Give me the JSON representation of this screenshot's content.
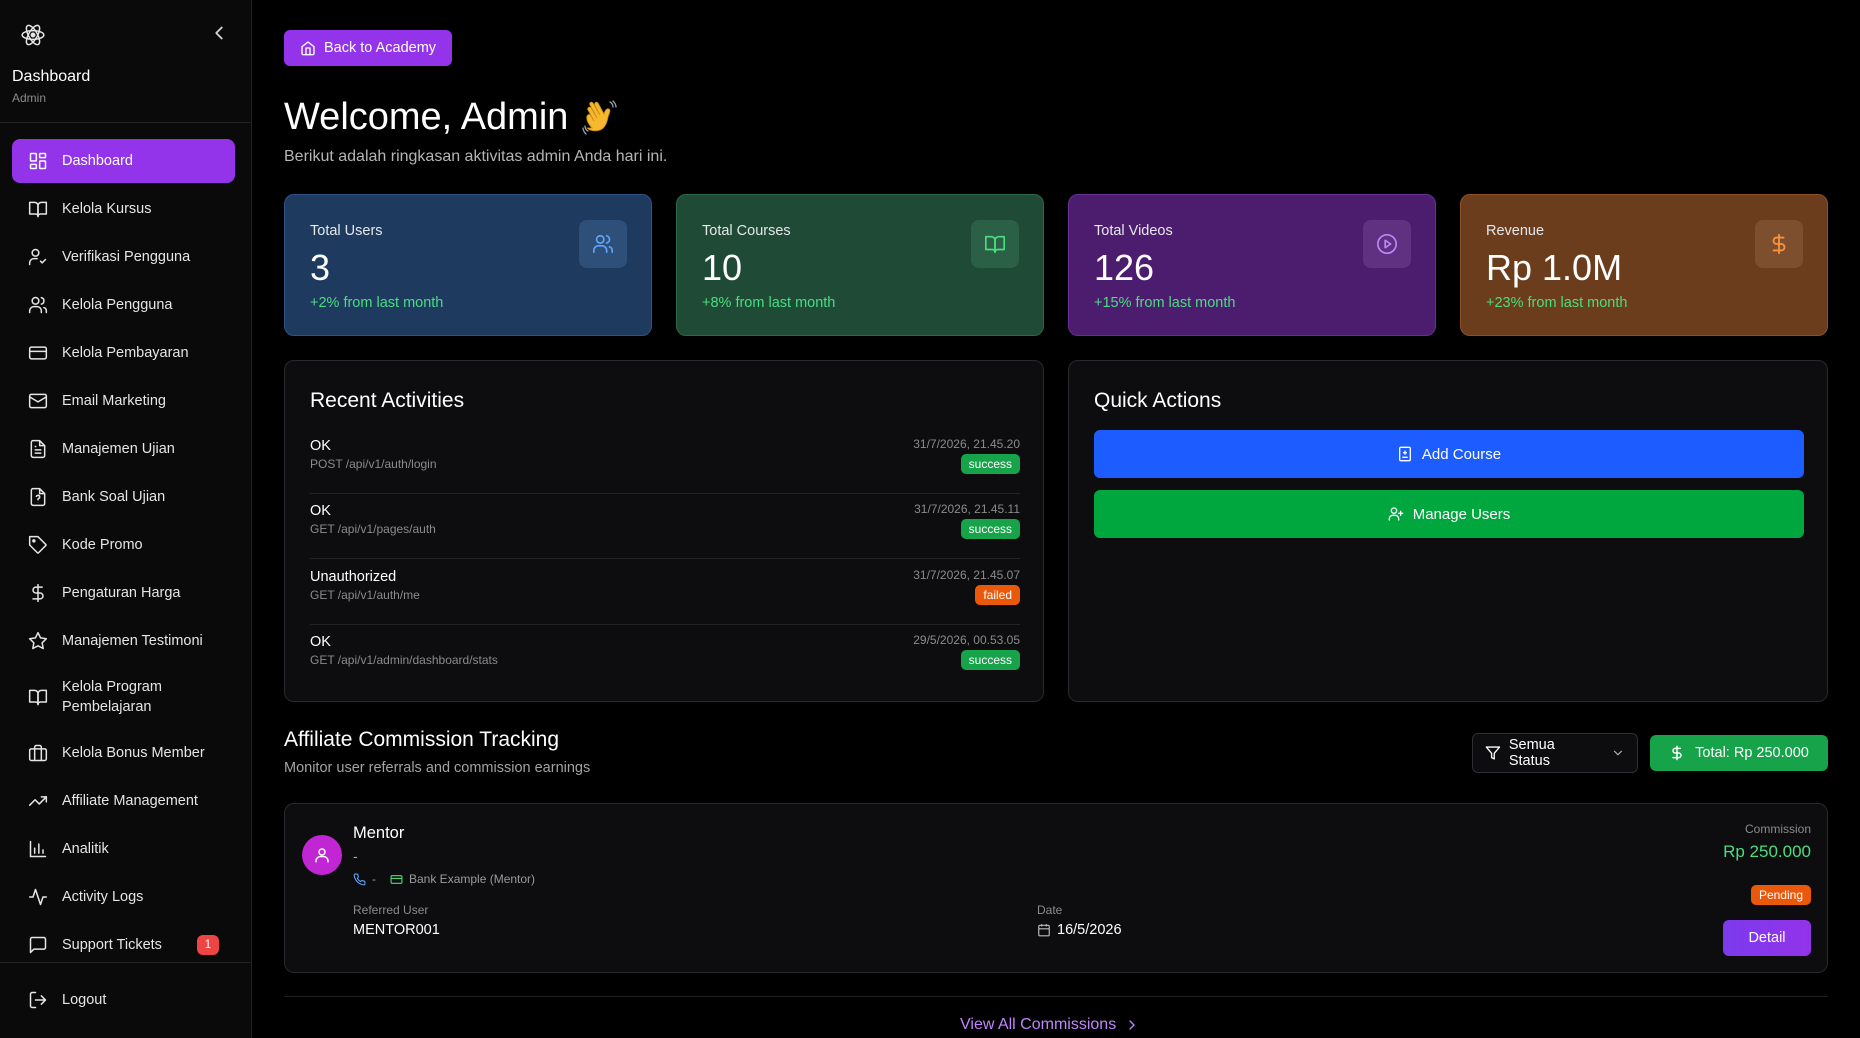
{
  "sidebar": {
    "title": "Dashboard",
    "subtitle": "Admin",
    "items": [
      {
        "label": "Dashboard",
        "icon": "layout-grid-icon"
      },
      {
        "label": "Kelola Kursus",
        "icon": "book-open-icon"
      },
      {
        "label": "Verifikasi Pengguna",
        "icon": "user-check-icon"
      },
      {
        "label": "Kelola Pengguna",
        "icon": "users-icon"
      },
      {
        "label": "Kelola Pembayaran",
        "icon": "credit-card-icon"
      },
      {
        "label": "Email Marketing",
        "icon": "mail-icon"
      },
      {
        "label": "Manajemen Ujian",
        "icon": "file-text-icon"
      },
      {
        "label": "Bank Soal Ujian",
        "icon": "file-question-icon"
      },
      {
        "label": "Kode Promo",
        "icon": "tag-icon"
      },
      {
        "label": "Pengaturan Harga",
        "icon": "dollar-sign-icon"
      },
      {
        "label": "Manajemen Testimoni",
        "icon": "star-icon"
      },
      {
        "label": "Kelola Program Pembelajaran",
        "icon": "book-open-icon"
      },
      {
        "label": "Kelola Bonus Member",
        "icon": "briefcase-icon"
      },
      {
        "label": "Affiliate Management",
        "icon": "trending-up-icon"
      },
      {
        "label": "Analitik",
        "icon": "bar-chart-icon"
      },
      {
        "label": "Activity Logs",
        "icon": "activity-icon"
      },
      {
        "label": "Support Tickets",
        "icon": "message-square-icon",
        "badge": "1"
      }
    ],
    "logout": "Logout"
  },
  "header": {
    "back_button": "Back to Academy",
    "welcome": "Welcome, Admin",
    "subtitle": "Berikut adalah ringkasan aktivitas admin Anda hari ini."
  },
  "stats": [
    {
      "label": "Total Users",
      "value": "3",
      "change": "+2% from last month",
      "icon": "users-icon",
      "bg": "#1e3a5f",
      "icon_color": "#60a5fa"
    },
    {
      "label": "Total Courses",
      "value": "10",
      "change": "+8% from last month",
      "icon": "book-open-icon",
      "bg": "#1f4a35",
      "icon_color": "#4ade80"
    },
    {
      "label": "Total Videos",
      "value": "126",
      "change": "+15% from last month",
      "icon": "play-circle-icon",
      "bg": "#4c1d6e",
      "icon_color": "#c084fc"
    },
    {
      "label": "Revenue",
      "value": "Rp 1.0M",
      "change": "+23% from last month",
      "icon": "dollar-sign-icon",
      "bg": "#6b3d1c",
      "icon_color": "#fb923c"
    }
  ],
  "recent": {
    "title": "Recent Activities",
    "items": [
      {
        "status": "OK",
        "path": "POST /api/v1/auth/login",
        "time": "31/7/2026, 21.45.20",
        "result": "success"
      },
      {
        "status": "OK",
        "path": "GET /api/v1/pages/auth",
        "time": "31/7/2026, 21.45.11",
        "result": "success"
      },
      {
        "status": "Unauthorized",
        "path": "GET /api/v1/auth/me",
        "time": "31/7/2026, 21.45.07",
        "result": "failed"
      },
      {
        "status": "OK",
        "path": "GET /api/v1/admin/dashboard/stats",
        "time": "29/5/2026, 00.53.05",
        "result": "success"
      }
    ]
  },
  "quick": {
    "title": "Quick Actions",
    "add_course": "Add Course",
    "manage_users": "Manage Users"
  },
  "affiliate": {
    "title": "Affiliate Commission Tracking",
    "subtitle": "Monitor user referrals and commission earnings",
    "status_filter": "Semua Status",
    "total": "Total: Rp 250.000",
    "card": {
      "name": "Mentor",
      "dash": "-",
      "phone": "-",
      "bank": "Bank Example (Mentor)",
      "referred_label": "Referred User",
      "referred_value": "MENTOR001",
      "date_label": "Date",
      "date_value": "16/5/2026",
      "commission_label": "Commission",
      "commission_value": "Rp 250.000",
      "status": "Pending",
      "detail": "Detail"
    },
    "view_all": "View All Commissions"
  },
  "colors": {
    "accent": "#9333ea",
    "success": "#16a34a",
    "failed": "#ea580c",
    "blue_button": "#1d5cff",
    "green_button": "#00a63e"
  }
}
